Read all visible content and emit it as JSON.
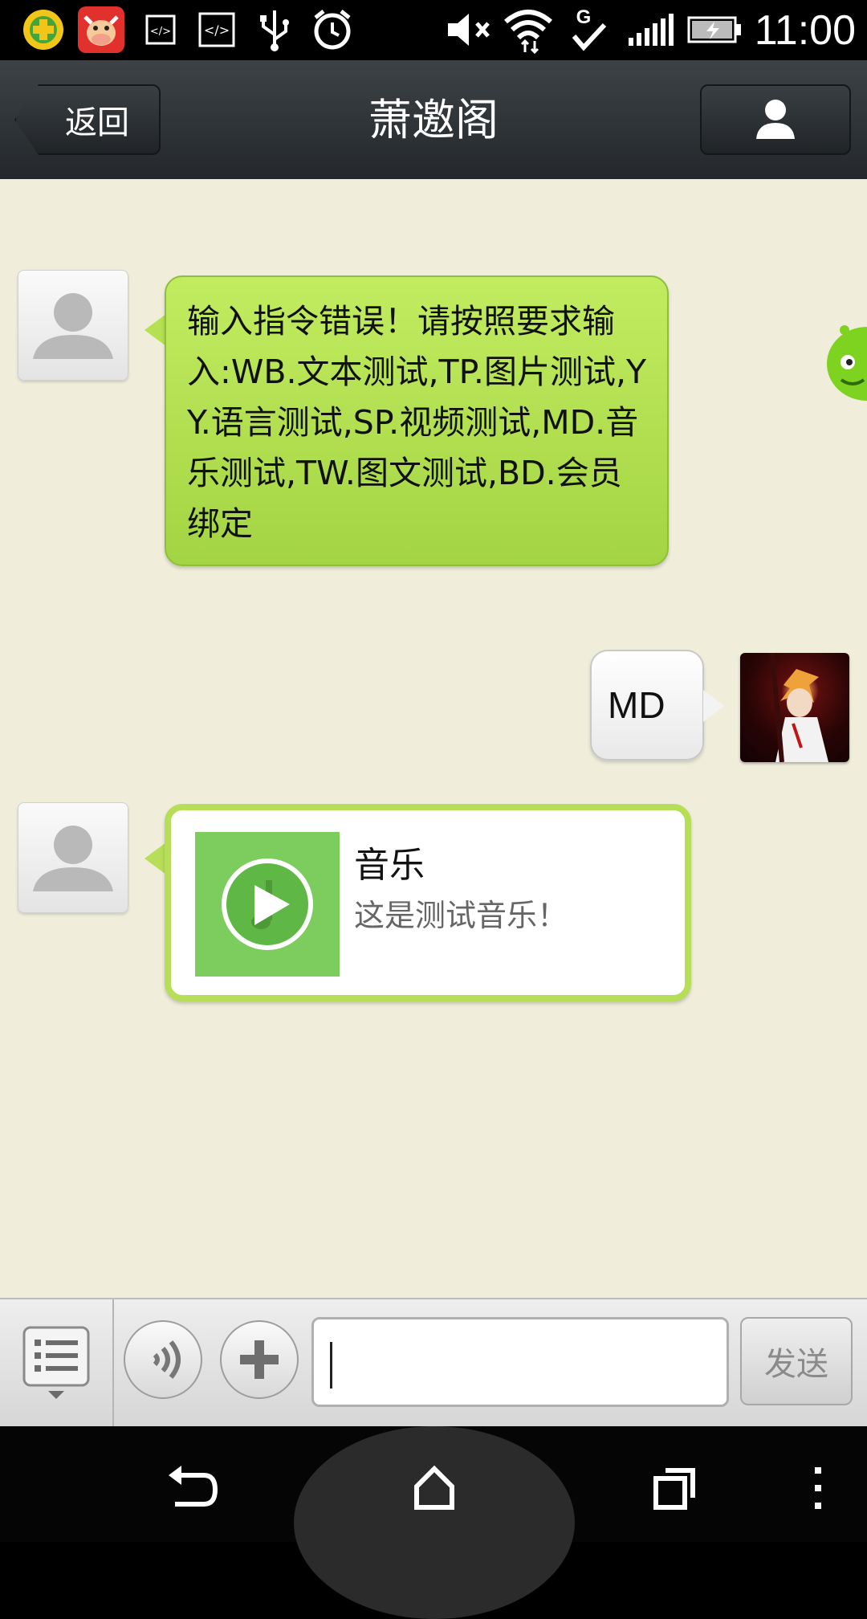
{
  "status_bar": {
    "time": "11:00",
    "icons": [
      "360-security-icon",
      "cow-app-icon",
      "code-icon",
      "code-bracket-icon",
      "usb-icon",
      "alarm-icon",
      "mute-icon",
      "wifi-icon",
      "sync-check-icon",
      "signal-icon",
      "battery-charging-icon"
    ]
  },
  "header": {
    "back_label": "返回",
    "title": "萧邀阁",
    "profile_icon": "person-icon"
  },
  "messages": [
    {
      "sender": "other",
      "type": "text",
      "text": "输入指令错误！请按照要求输入:WB.文本测试,TP.图片测试,YY.语言测试,SP.视频测试,MD.音乐测试,TW.图文测试,BD.会员绑定"
    },
    {
      "sender": "me",
      "type": "text",
      "text": "MD"
    },
    {
      "sender": "other",
      "type": "music",
      "title": "音乐",
      "description": "这是测试音乐！",
      "thumb_icon": "play-music-icon"
    }
  ],
  "input_bar": {
    "send_label": "发送",
    "input_value": "",
    "menu_icon": "menu-list-icon",
    "voice_icon": "voice-icon",
    "add_icon": "plus-icon"
  },
  "nav_bar": {
    "icons": [
      "back-icon",
      "home-icon",
      "recent-apps-icon",
      "overflow-menu-icon"
    ]
  },
  "colors": {
    "chat_background": "#f0eedb",
    "green_bubble": "#b4e151",
    "header": "#2e3336"
  }
}
